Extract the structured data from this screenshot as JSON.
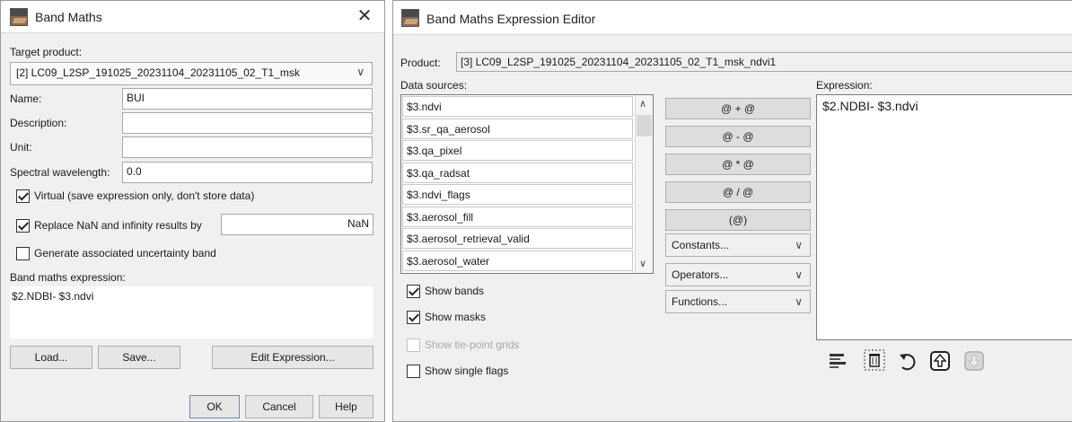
{
  "band_maths": {
    "title": "Band Maths",
    "close_glyph": "✕",
    "target_product_label": "Target product:",
    "target_product_value": "[2] LC09_L2SP_191025_20231104_20231105_02_T1_msk",
    "name_label": "Name:",
    "name_value": "BUI",
    "description_label": "Description:",
    "description_value": "",
    "unit_label": "Unit:",
    "unit_value": "",
    "spectral_label": "Spectral wavelength:",
    "spectral_value": "0.0",
    "virtual_label": "Virtual (save expression only, don't store data)",
    "virtual_checked": true,
    "replace_nan_label": "Replace NaN and infinity results by",
    "replace_nan_checked": true,
    "replace_nan_value": "NaN",
    "uncertainty_label": "Generate associated uncertainty band",
    "uncertainty_checked": false,
    "expression_label": "Band maths expression:",
    "expression_value": "$2.NDBI- $3.ndvi",
    "load_label": "Load...",
    "save_label": "Save...",
    "edit_expression_label": "Edit Expression...",
    "ok_label": "OK",
    "cancel_label": "Cancel",
    "help_label": "Help"
  },
  "expression_editor": {
    "title": "Band Maths Expression Editor",
    "product_label": "Product:",
    "product_value": "[3] LC09_L2SP_191025_20231104_20231105_02_T1_msk_ndvi1",
    "data_sources_label": "Data sources:",
    "data_sources": [
      "$3.ndvi",
      "$3.sr_qa_aerosol",
      "$3.qa_pixel",
      "$3.qa_radsat",
      "$3.ndvi_flags",
      "$3.aerosol_fill",
      "$3.aerosol_retrieval_valid",
      "$3.aerosol_water"
    ],
    "operator_buttons": [
      "@ + @",
      "@ - @",
      "@ * @",
      "@ / @",
      "(@)"
    ],
    "constants_label": "Constants...",
    "operators_label": "Operators...",
    "functions_label": "Functions...",
    "show_bands_label": "Show bands",
    "show_bands_checked": true,
    "show_masks_label": "Show masks",
    "show_masks_checked": true,
    "show_tie_point_label": "Show tie-point grids",
    "show_tie_point_enabled": false,
    "show_single_flags_label": "Show single flags",
    "show_single_flags_checked": false,
    "expression_label": "Expression:",
    "expression_value": "$2.NDBI- $3.ndvi",
    "toolbar_icons": [
      "clear-icon",
      "delete-icon",
      "undo-icon",
      "upload-icon",
      "download-icon"
    ]
  },
  "colors": {
    "window_bg": "#f0f0f0",
    "button_bg": "#e6e6e6",
    "operator_button_bg": "#dddddd",
    "border": "#a8a8a8"
  }
}
